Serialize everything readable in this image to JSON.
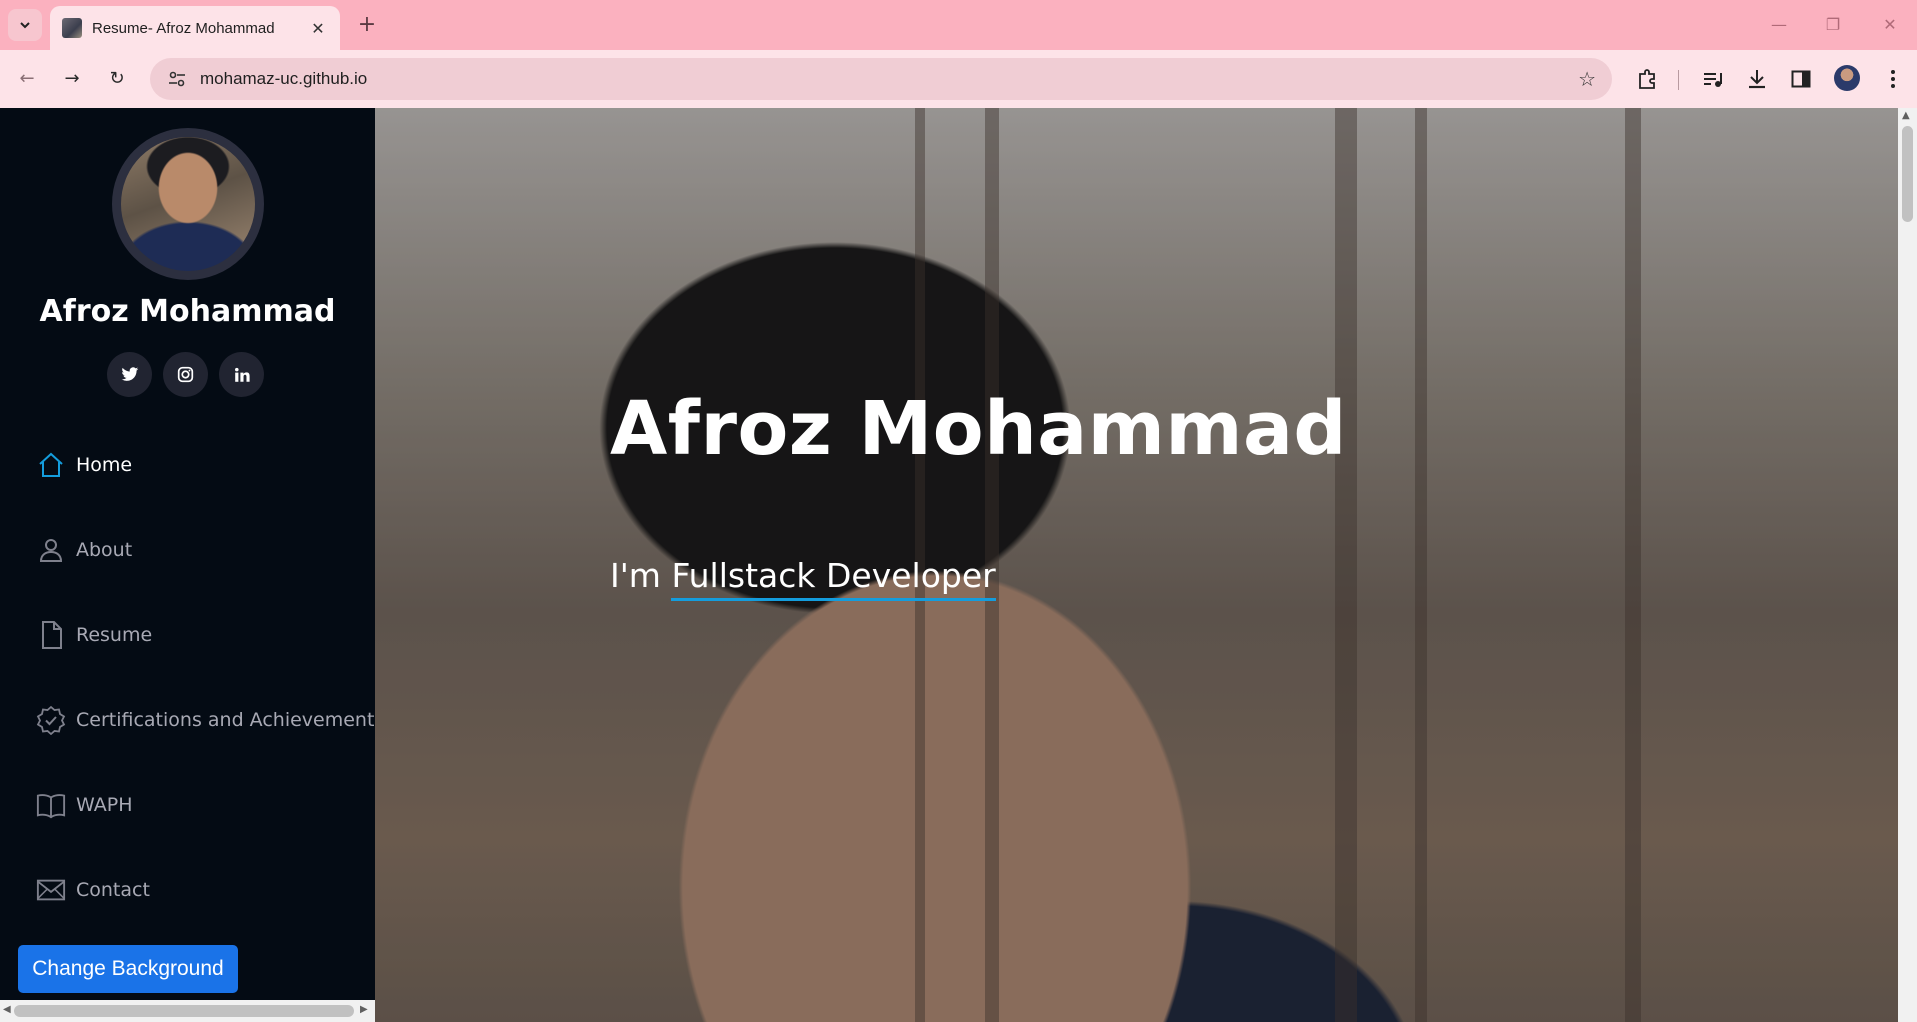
{
  "browser": {
    "tab_title": "Resume- Afroz Mohammad",
    "tab_close": "✕",
    "new_tab": "+",
    "url": "mohamaz-uc.github.io",
    "window_controls": {
      "minimize": "—",
      "restore": "❐",
      "close": "✕"
    },
    "nav": {
      "back": "←",
      "forward": "→",
      "reload": "↻"
    },
    "star": "☆"
  },
  "sidebar": {
    "name": "Afroz Mohammad",
    "socials": [
      {
        "icon": "twitter-icon",
        "glyph": "t"
      },
      {
        "icon": "instagram-icon",
        "glyph": "◎"
      },
      {
        "icon": "linkedin-icon",
        "glyph": "in"
      }
    ],
    "nav_items": [
      {
        "label": "Home",
        "icon": "home-icon",
        "active": true
      },
      {
        "label": "About",
        "icon": "person-icon",
        "active": false
      },
      {
        "label": "Resume",
        "icon": "file-icon",
        "active": false
      },
      {
        "label": "Certifications and Achievements",
        "icon": "award-icon",
        "active": false
      },
      {
        "label": "WAPH",
        "icon": "book-icon",
        "active": false
      },
      {
        "label": "Contact",
        "icon": "envelope-icon",
        "active": false
      }
    ],
    "change_background_label": "Change Background"
  },
  "hero": {
    "title": "Afroz Mohammad",
    "subtitle_prefix": "I'm ",
    "subtitle_typed": "Fullstack Developer"
  },
  "colors": {
    "accent": "#149ddd",
    "button": "#1a73e8",
    "sidebar_bg": "#040b14",
    "chrome": "#fbb1bf"
  }
}
